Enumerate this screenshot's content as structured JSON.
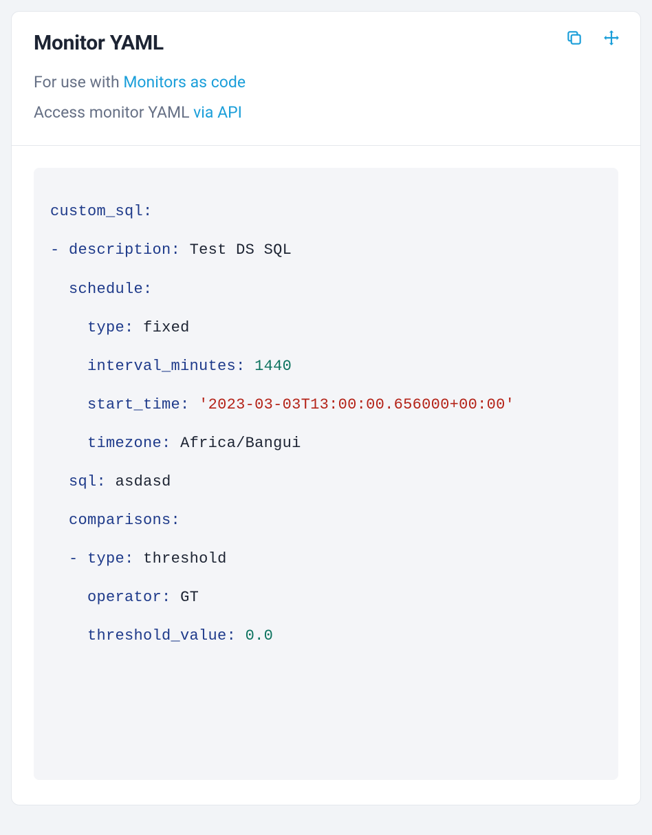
{
  "header": {
    "title": "Monitor YAML",
    "sub1_prefix": "For use with ",
    "sub1_link": "Monitors as code",
    "sub2_prefix": "Access monitor YAML ",
    "sub2_link": "via API"
  },
  "yaml": {
    "root_key": "custom_sql",
    "description_key": "description",
    "description_val": "Test DS SQL",
    "schedule_key": "schedule",
    "schedule_type_key": "type",
    "schedule_type_val": "fixed",
    "interval_key": "interval_minutes",
    "interval_val": "1440",
    "start_time_key": "start_time",
    "start_time_val": "'2023-03-03T13:00:00.656000+00:00'",
    "timezone_key": "timezone",
    "timezone_val": "Africa/Bangui",
    "sql_key": "sql",
    "sql_val": "asdasd",
    "comparisons_key": "comparisons",
    "cmp_type_key": "type",
    "cmp_type_val": "threshold",
    "operator_key": "operator",
    "operator_val": "GT",
    "threshold_key": "threshold_value",
    "threshold_val": "0.0"
  }
}
